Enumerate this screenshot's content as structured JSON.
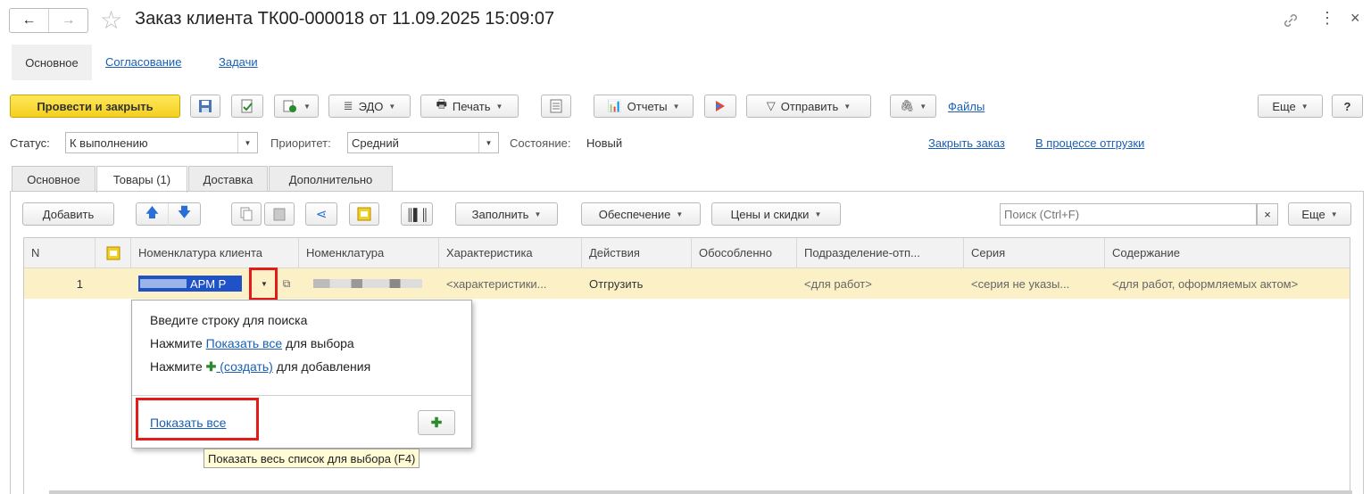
{
  "window": {
    "title": "Заказ клиента ТК00-000018 от 11.09.2025 15:09:07",
    "back_icon": "←",
    "forward_icon": "→",
    "star_icon": "☆",
    "link_icon": "🔗",
    "more_icon": "⋮",
    "close_icon": "×"
  },
  "nav_links": {
    "main": "Основное",
    "approval": "Согласование",
    "tasks": "Задачи"
  },
  "toolbar": {
    "post_close": "Провести и закрыть",
    "edo": "ЭДО",
    "print": "Печать",
    "reports": "Отчеты",
    "send": "Отправить",
    "files": "Файлы",
    "more": "Еще",
    "help": "?"
  },
  "status_row": {
    "status_label": "Статус:",
    "status_value": "К выполнению",
    "priority_label": "Приоритет:",
    "priority_value": "Средний",
    "state_label": "Состояние:",
    "state_value": "Новый",
    "close_order": "Закрыть заказ",
    "in_shipment": "В процессе отгрузки"
  },
  "tabs": [
    "Основное",
    "Товары (1)",
    "Доставка",
    "Дополнительно"
  ],
  "goods_toolbar": {
    "add": "Добавить",
    "fill": "Заполнить",
    "supply": "Обеспечение",
    "prices": "Цены и скидки",
    "search_placeholder": "Поиск (Ctrl+F)",
    "clear": "×",
    "more": "Еще"
  },
  "table": {
    "headers": [
      "N",
      "",
      "Номенклатура клиента",
      "Номенклатура",
      "Характеристика",
      "Действия",
      "Обособленно",
      "Подразделение-отп...",
      "Серия",
      "Содержание"
    ],
    "rows": [
      {
        "n": "1",
        "client_item": "АРМ Р",
        "item": "",
        "characteristic": "<характеристики...",
        "action": "Отгрузить",
        "separate": "",
        "department": "<для работ>",
        "series": "<серия не указы...",
        "content": "<для работ, оформляемых актом>"
      }
    ]
  },
  "popup": {
    "line1": "Введите строку для поиска",
    "line2_pre": "Нажмите ",
    "line2_link": "Показать все",
    "line2_post": " для выбора",
    "line3_pre": "Нажмите ",
    "line3_plus": "✚",
    "line3_link": " (создать)",
    "line3_post": " для добавления",
    "show_all": "Показать все",
    "add_plus": "✚"
  },
  "tooltip": "Показать весь список для выбора (F4)",
  "colors": {
    "primary": "#f5cf1f",
    "link": "#1a5fb4",
    "row_highlight": "#fbf0c6",
    "annotation_red": "#e21b1b",
    "plus_green": "#2b8a2b"
  }
}
